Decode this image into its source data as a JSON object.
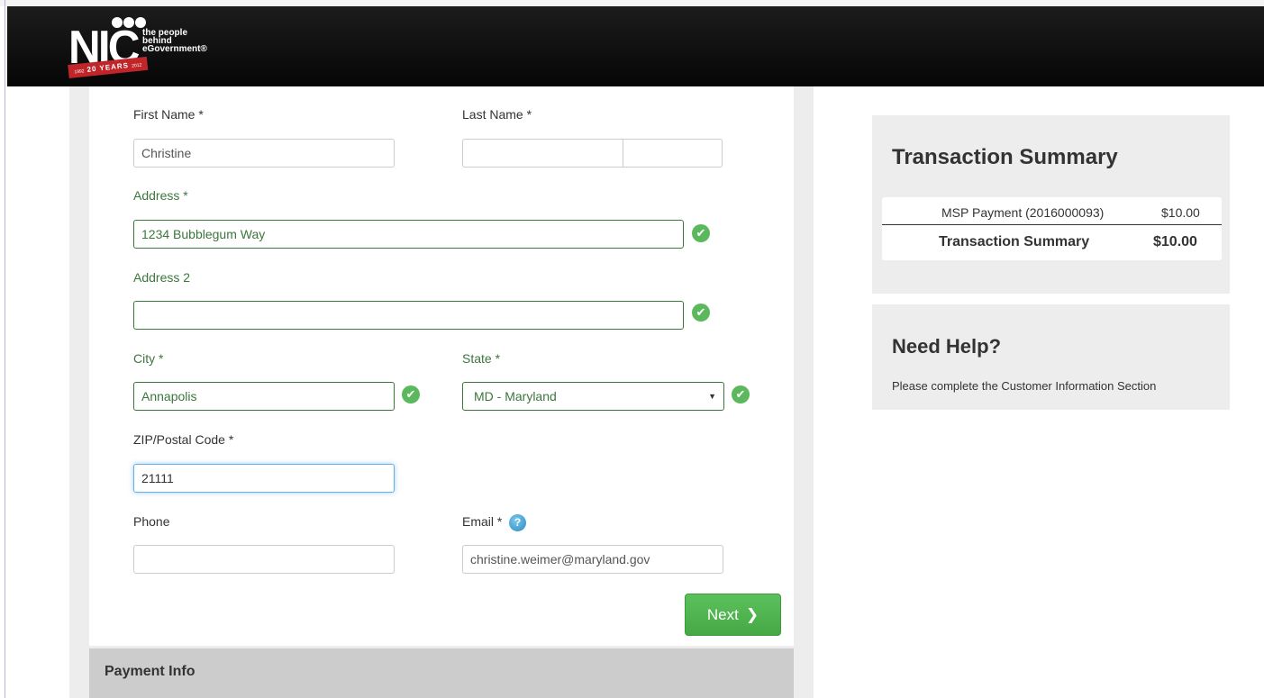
{
  "header": {
    "logo_text": "NIC",
    "logo_tm": "™",
    "logo_tagline": [
      "the people",
      "behind",
      "eGovernment®"
    ],
    "logo_ribbon": "20 YEARS",
    "logo_ribbon_start": "1992",
    "logo_ribbon_end": "2012"
  },
  "form": {
    "first_name": {
      "label": "First Name *",
      "value": "Christine"
    },
    "last_name": {
      "label": "Last Name *",
      "value": ""
    },
    "address": {
      "label": "Address *",
      "value": "1234 Bubblegum Way"
    },
    "address2": {
      "label": "Address 2",
      "value": ""
    },
    "city": {
      "label": "City *",
      "value": "Annapolis"
    },
    "state": {
      "label": "State *",
      "value": "MD - Maryland"
    },
    "zip": {
      "label": "ZIP/Postal Code *",
      "value": "21111"
    },
    "phone": {
      "label": "Phone",
      "value": ""
    },
    "email": {
      "label": "Email *",
      "value": "christine.weimer@maryland.gov"
    },
    "next_label": "Next",
    "help_icon_glyph": "?",
    "check_glyph": "✔",
    "select_arrow_glyph": "▼",
    "next_chevron_glyph": "❯"
  },
  "payment": {
    "title": "Payment Info"
  },
  "summary": {
    "title": "Transaction Summary",
    "item_label": "MSP Payment (2016000093)",
    "item_amount": "$10.00",
    "total_label": "Transaction Summary",
    "total_amount": "$10.00"
  },
  "help": {
    "title": "Need Help?",
    "text": "Please complete the Customer Information Section"
  },
  "colors": {
    "valid_green": "#3c763d",
    "button_green": "#5cb85c",
    "focus_blue": "#66afe9",
    "header_black": "#0a0a0a"
  },
  "icons": {
    "valid": "check-circle-icon",
    "help": "question-circle-icon",
    "next": "chevron-right-icon",
    "select": "caret-down-icon"
  }
}
